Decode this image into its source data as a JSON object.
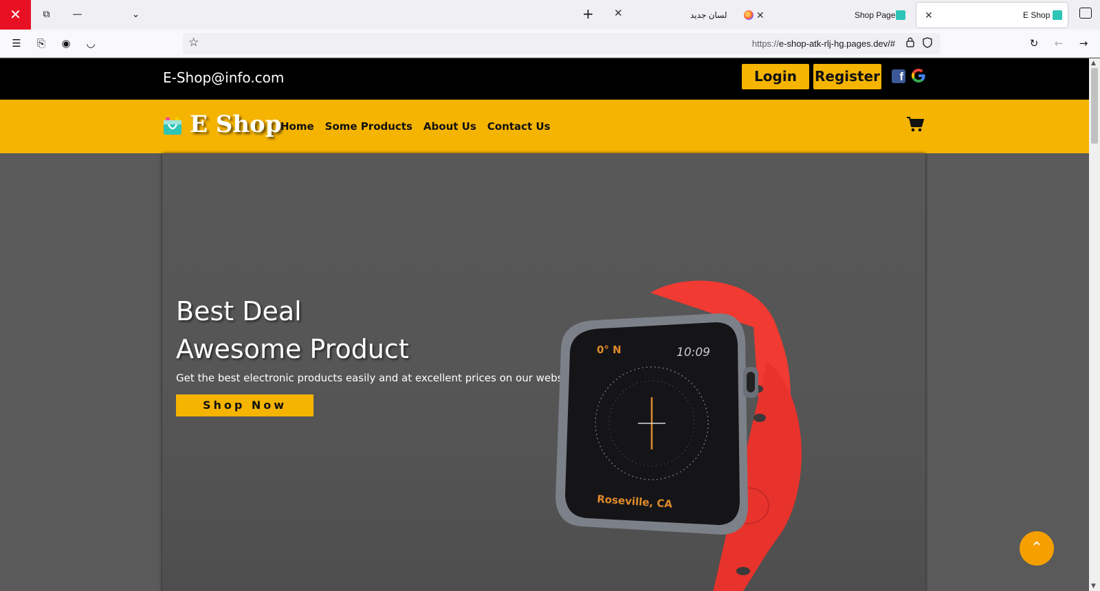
{
  "browser": {
    "tabs": [
      {
        "title": "E Shop",
        "active": true,
        "favicon": "eshop-bag-icon"
      },
      {
        "title": "Shop Page",
        "active": false,
        "favicon": "eshop-bag-icon"
      },
      {
        "title": "لسان جدید",
        "active": false,
        "favicon": "firefox-icon"
      }
    ],
    "url_scheme": "https://",
    "url_host": "e-shop-atk-rlj-hg.pages.dev/#"
  },
  "header": {
    "email": "E-Shop@info.com",
    "login_label": "Login",
    "register_label": "Register",
    "facebook_glyph": "f"
  },
  "nav": {
    "logo_text": "E Shop",
    "items": [
      "Home",
      "Some Products",
      "About Us",
      "Contact Us"
    ]
  },
  "hero": {
    "title_line1": "Best Deal",
    "title_line2": "Awesome Product",
    "description": "Get the best electronic products easily and at excellent prices on our website.",
    "cta_label": "Shop Now",
    "watch_readouts": {
      "heading": "0° N",
      "time": "10:09",
      "location": "Roseville, CA"
    }
  },
  "colors": {
    "accent_yellow": "#f5b400",
    "scroll_top_orange": "#f5a000",
    "top_strip": "#000000"
  }
}
